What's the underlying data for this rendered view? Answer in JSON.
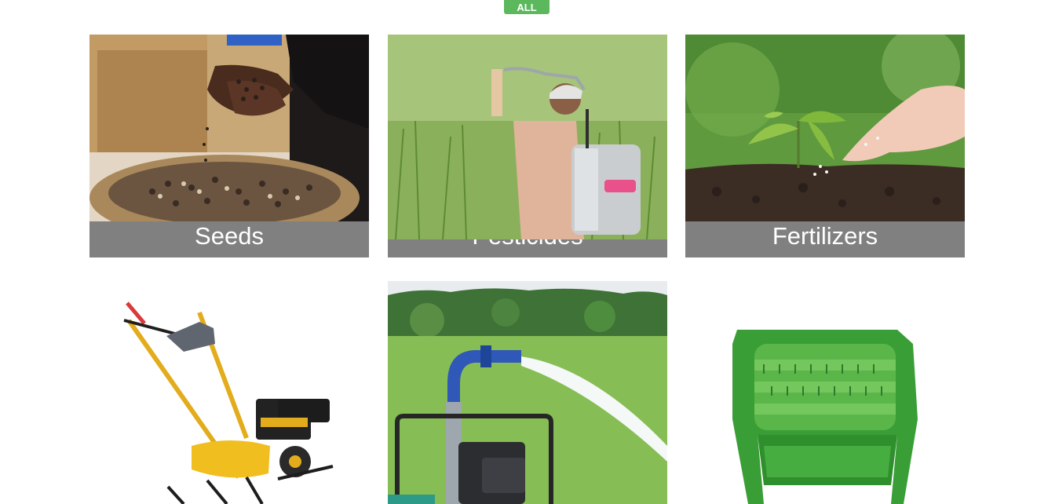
{
  "filter": {
    "all_label": "ALL",
    "accent_color": "#5cb85c"
  },
  "categories": [
    {
      "label": "Seeds",
      "image": "seeds-in-hands-photo"
    },
    {
      "label": "Pesticides",
      "image": "farmer-spraying-field-photo"
    },
    {
      "label": "Fertilizers",
      "image": "seedling-in-soil-photo"
    }
  ],
  "products": [
    {
      "image": "yellow-power-tiller-photo"
    },
    {
      "image": "water-pump-irrigating-field-photo"
    },
    {
      "image": "green-threshing-drum-photo"
    }
  ],
  "caption_color": "#808080"
}
